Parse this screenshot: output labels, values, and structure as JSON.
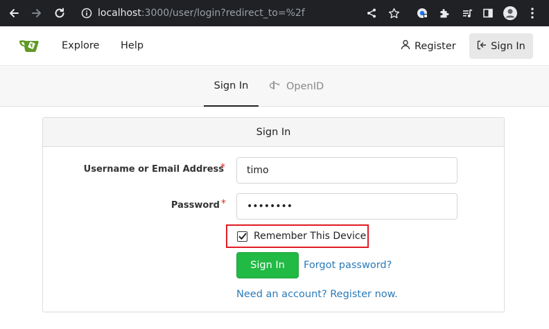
{
  "browser": {
    "url_host": "localhost",
    "url_path": ":3000/user/login?redirect_to=%2f"
  },
  "navbar": {
    "explore": "Explore",
    "help": "Help",
    "register": "Register",
    "sign_in": "Sign In"
  },
  "tabs": {
    "sign_in": "Sign In",
    "openid": "OpenID"
  },
  "form": {
    "header": "Sign In",
    "username_label": "Username or Email Address",
    "username_value": "timo",
    "password_label": "Password",
    "password_value": "timotimo",
    "required_marker": "*",
    "remember_label": "Remember This Device",
    "remember_checked": true,
    "submit": "Sign In",
    "forgot": "Forgot password?",
    "register_now": "Need an account? Register now."
  },
  "colors": {
    "chrome_bg": "#202124",
    "primary_green": "#21ba45",
    "link_blue": "#2a7ab8",
    "highlight_red": "#e01b24",
    "required_red": "#db2828"
  }
}
